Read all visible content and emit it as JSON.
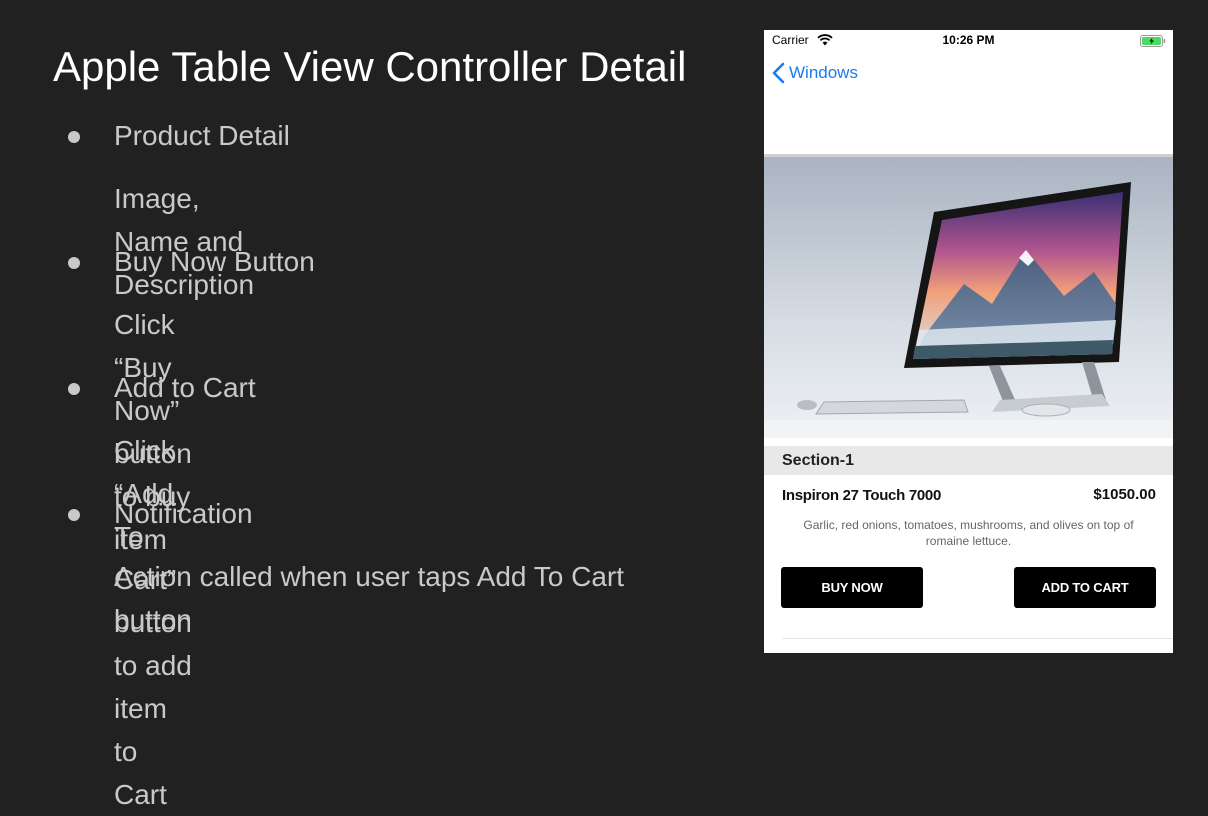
{
  "slide": {
    "title": "Apple Table View Controller Detail",
    "bullets": [
      {
        "label": "Product Detail",
        "sub": "Image, Name and Description"
      },
      {
        "label": "Buy Now Button",
        "sub": "Click “Buy Now” button to buy item"
      },
      {
        "label": "Add to Cart",
        "sub": "Click “Add To Cart” button to add item to Cart"
      },
      {
        "label": "Notification",
        "sub": "Action called when user taps Add To Cart button"
      }
    ]
  },
  "phone": {
    "status": {
      "carrier": "Carrier",
      "time": "10:26 PM"
    },
    "nav": {
      "back_label": "Windows"
    },
    "section": {
      "title": "Section-1"
    },
    "product": {
      "name": "Inspiron 27 Touch 7000",
      "price": "$1050.00",
      "description": "Garlic, red onions, tomatoes, mushrooms, and olives on top of romaine lettuce."
    },
    "buttons": {
      "buy_now": "BUY NOW",
      "add_to_cart": "ADD TO CART"
    }
  },
  "icons": {
    "wifi": "wifi-icon",
    "battery": "battery-icon",
    "back": "chevron-left-icon"
  },
  "colors": {
    "background": "#212121",
    "nav_tint": "#1a7cf0",
    "battery": "#4cd964"
  }
}
